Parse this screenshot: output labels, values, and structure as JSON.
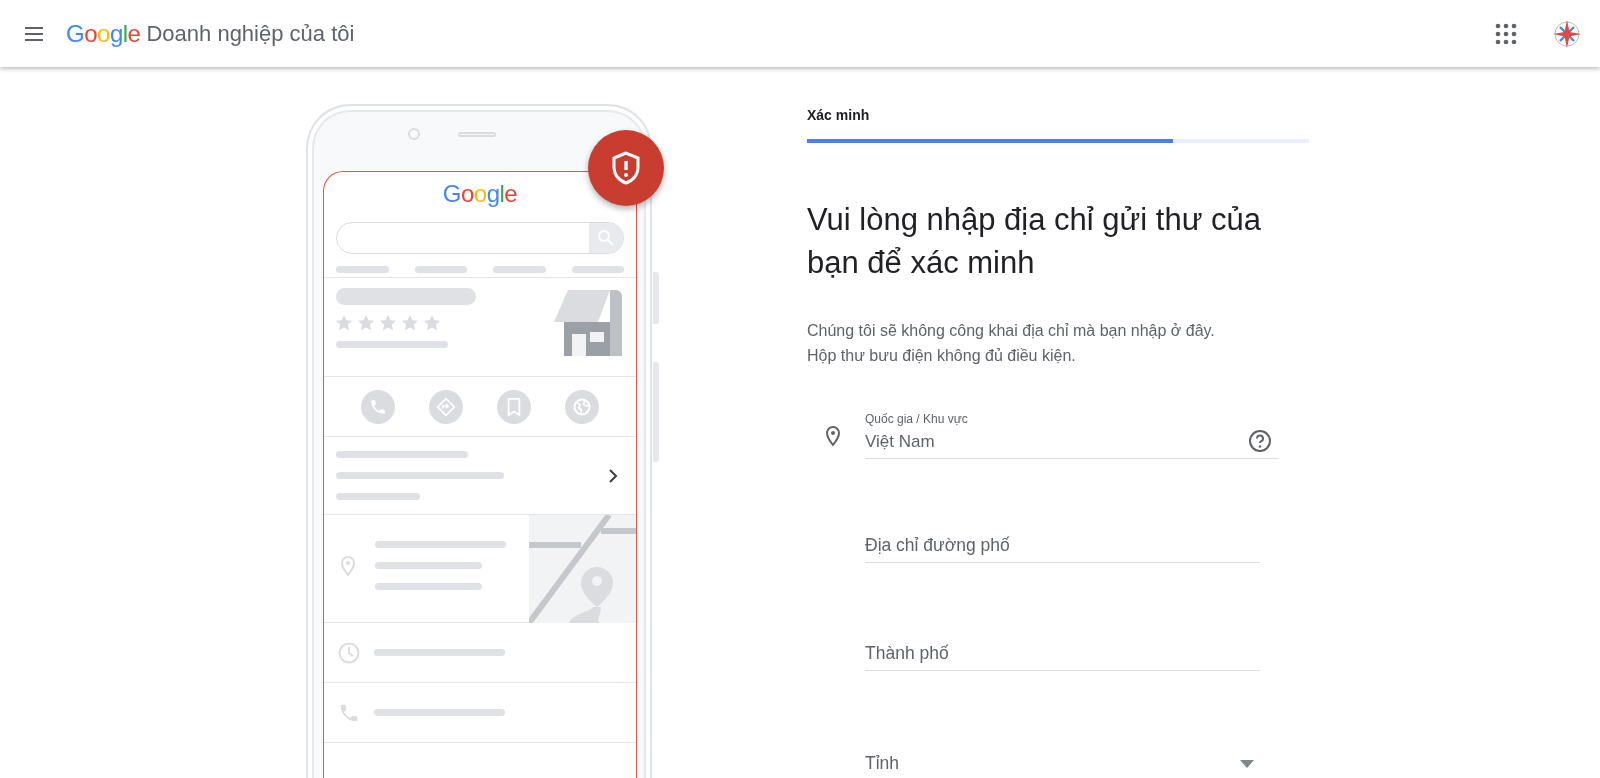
{
  "header": {
    "logo": "Google",
    "product": "Doanh nghiệp của tôi"
  },
  "illustration": {
    "logo": "Google"
  },
  "step": {
    "label": "Xác minh",
    "level": 0.73
  },
  "title": "Vui lòng nhập địa chỉ gửi thư của bạn để xác minh",
  "description_lines": [
    "Chúng tôi sẽ không công khai địa chỉ mà bạn nhập ở đây.",
    "Hộp thư bưu điện không đủ điều kiện."
  ],
  "fields": [
    {
      "kind": "country",
      "label": "Quốc gia / Khu vực",
      "value": "Việt Nam"
    },
    {
      "kind": "text",
      "placeholder": "Địa chỉ đường phố"
    },
    {
      "kind": "text",
      "placeholder": "Thành phố"
    },
    {
      "kind": "dropdown",
      "placeholder": "Tỉnh"
    }
  ]
}
